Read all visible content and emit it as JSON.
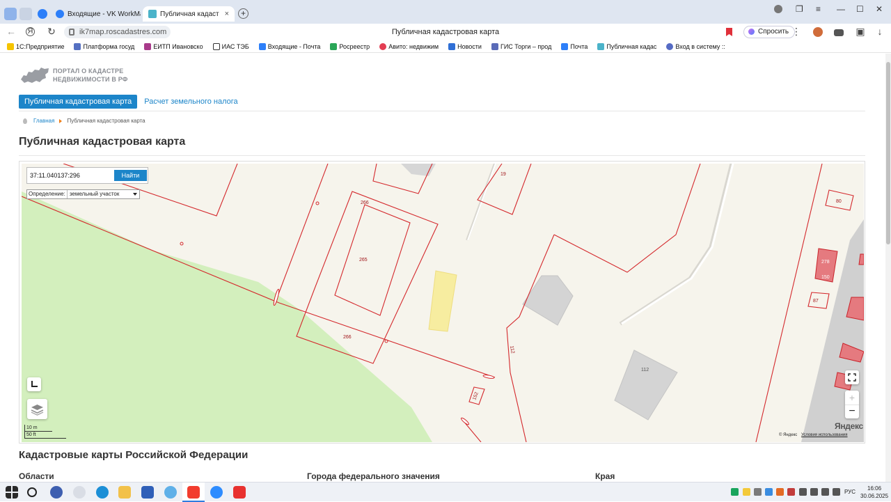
{
  "browser": {
    "tabs": [
      {
        "label": "Входящие - VK WorkMail",
        "active": false
      },
      {
        "label": "Публичная кадастрова",
        "active": true
      }
    ],
    "url": "ik7map.roscadastres.com",
    "page_title": "Публичная кадастровая карта",
    "ask_label": "Спросить",
    "bookmarks": [
      "1С:Предприятие",
      "Платформа госуд",
      "ЕИТП Ивановско",
      "ИАС ТЭБ",
      "Входящие - Почта",
      "Росреестр",
      "Авито: недвижим",
      "Новости",
      "ГИС Торги – прод",
      "Почта",
      "Публичная кадас",
      "Вход в систему ::"
    ]
  },
  "site": {
    "logo_line1": "ПОРТАЛ О КАДАСТРЕ",
    "logo_line2": "НЕДВИЖИМОСТИ В РФ",
    "menu": [
      "Публичная кадастровая карта",
      "Расчет земельного налога"
    ],
    "breadcrumb_home": "Главная",
    "breadcrumb_current": "Публичная кадастровая карта",
    "heading": "Публичная кадастровая карта"
  },
  "map": {
    "search_value": "37:11.040137:296",
    "search_button": "Найти",
    "definition_label": "Определение:",
    "definition_value": "земельный участок",
    "scale_1": "10 m",
    "scale_2": "50 ft",
    "yandex_logo": "Яндекс",
    "copyright": "© Яндекс",
    "terms": "Условия использования",
    "parcel_labels": [
      "19",
      "266",
      "265",
      "266",
      "112",
      "112",
      "80",
      "278",
      "150",
      "87",
      "152"
    ]
  },
  "section": {
    "heading": "Кадастровые карты Российской Федерации",
    "columns": [
      "Области",
      "Города федерального значения",
      "Края"
    ]
  },
  "taskbar": {
    "lang": "РУС",
    "time": "16:06",
    "date": "30.06.2025"
  }
}
